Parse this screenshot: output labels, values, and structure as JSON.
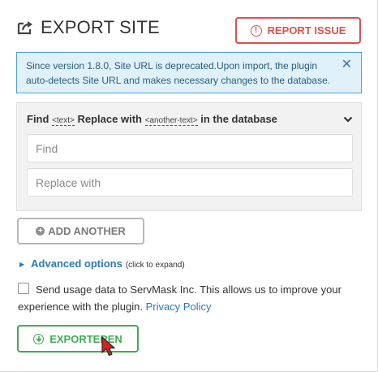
{
  "header": {
    "title": "EXPORT SITE",
    "icon": "export-icon"
  },
  "report_button": {
    "label": "REPORT ISSUE",
    "icon": "exclamation-circle-icon",
    "color": "#e04d4d"
  },
  "notice": {
    "text": "Since version 1.8.0, Site URL is deprecated.Upon import, the plugin auto-detects Site URL and makes necessary changes to the database.",
    "close_glyph": "✕",
    "bg": "#e0f1fa",
    "border": "#4ba0d3"
  },
  "find_replace": {
    "title_find": "Find",
    "tag_text": "<text>",
    "title_replace_with": "Replace with",
    "tag_another": "<another-text>",
    "title_suffix": "in the database",
    "find_placeholder": "Find",
    "replace_placeholder": "Replace with"
  },
  "add_another": {
    "label": "ADD ANOTHER",
    "plus": "+"
  },
  "advanced": {
    "label": "Advanced options",
    "hint": "(click to expand)",
    "arrow": "▶"
  },
  "usage": {
    "text": "Send usage data to ServMask Inc. This allows us to improve your experience with the plugin.",
    "link": "Privacy Policy",
    "checked": false
  },
  "export_button": {
    "label": "EXPORTEREN",
    "icon": "arrow-down-circle-icon",
    "color": "#3dad54"
  }
}
